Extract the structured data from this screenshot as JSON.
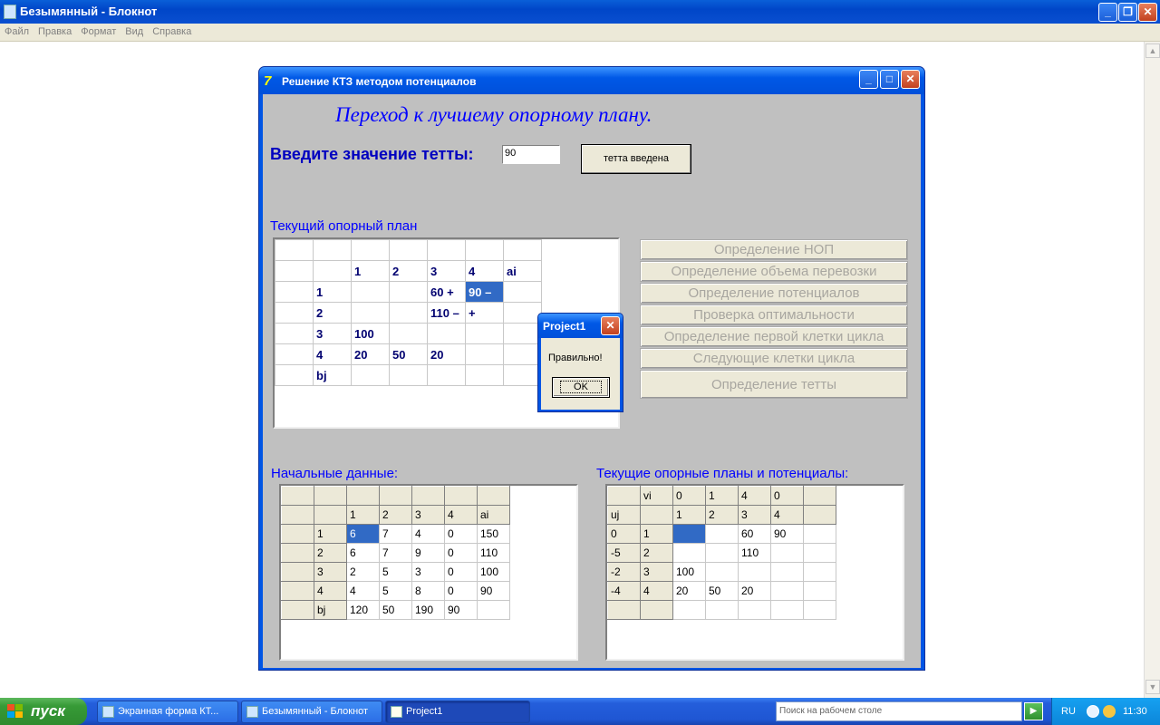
{
  "notepad": {
    "title": "Безымянный - Блокнот",
    "menu": [
      "Файл",
      "Правка",
      "Формат",
      "Вид",
      "Справка"
    ]
  },
  "app": {
    "title": "Решение КТЗ методом потенциалов",
    "heading": "Переход к лучшему опорному плану.",
    "theta_label": "Введите значение тетты:",
    "theta_value": "90",
    "theta_button": "тетта введена",
    "current_plan_label": "Текущий опорный план",
    "current_plan": [
      [
        "",
        "",
        "",
        "",
        "",
        "",
        ""
      ],
      [
        "",
        "",
        "1",
        "2",
        "3",
        "4",
        "ai"
      ],
      [
        "",
        "1",
        "",
        "",
        "60  +",
        "90  –",
        ""
      ],
      [
        "",
        "2",
        "",
        "",
        "110  –",
        "  +",
        ""
      ],
      [
        "",
        "3",
        "100",
        "",
        "",
        "",
        ""
      ],
      [
        "",
        "4",
        "20",
        "50",
        "20",
        "",
        ""
      ],
      [
        "",
        "bj",
        "",
        "",
        "",
        "",
        ""
      ]
    ],
    "steps": [
      "Определение НОП",
      "Определение объема перевозки",
      "Определение потенциалов",
      "Проверка оптимальности",
      "Определение первой клетки цикла",
      "Следующие клетки цикла",
      "Определение тетты"
    ],
    "initial_label": "Начальные данные:",
    "initial": [
      [
        "",
        "",
        "",
        "",
        "",
        "",
        ""
      ],
      [
        "",
        "",
        "1",
        "2",
        "3",
        "4",
        "ai"
      ],
      [
        "",
        "1",
        "6",
        "7",
        "4",
        "0",
        "150"
      ],
      [
        "",
        "2",
        "6",
        "7",
        "9",
        "0",
        "110"
      ],
      [
        "",
        "3",
        "2",
        "5",
        "3",
        "0",
        "100"
      ],
      [
        "",
        "4",
        "4",
        "5",
        "8",
        "0",
        "90"
      ],
      [
        "",
        "bj",
        "120",
        "50",
        "190",
        "90",
        ""
      ]
    ],
    "potentials_label": "Текущие опорные планы и потенциалы:",
    "potentials": [
      [
        "",
        "vi",
        "0",
        "1",
        "4",
        "0",
        ""
      ],
      [
        "uj",
        "",
        "1",
        "2",
        "3",
        "4",
        ""
      ],
      [
        "0",
        "1",
        "",
        "",
        "60",
        "90",
        ""
      ],
      [
        "-5",
        "2",
        "",
        "",
        "110",
        "",
        ""
      ],
      [
        "-2",
        "3",
        "100",
        "",
        "",
        "",
        ""
      ],
      [
        "-4",
        "4",
        "20",
        "50",
        "20",
        "",
        ""
      ],
      [
        "",
        "",
        "",
        "",
        "",
        "",
        ""
      ]
    ]
  },
  "dialog": {
    "title": "Project1",
    "message": "Правильно!",
    "ok": "OK"
  },
  "taskbar": {
    "start": "пуск",
    "tasks": [
      "Экранная форма КТ...",
      "Безымянный - Блокнот",
      "Project1"
    ],
    "search_placeholder": "Поиск на рабочем столе",
    "lang": "RU",
    "clock": "11:30"
  },
  "colors": {
    "title_blue": "#0055e5",
    "form_gray": "#c0c0c0",
    "label_blue": "#0000ff",
    "selection": "#316ac5",
    "taskbar": "#245edb",
    "start_green": "#379a37"
  }
}
